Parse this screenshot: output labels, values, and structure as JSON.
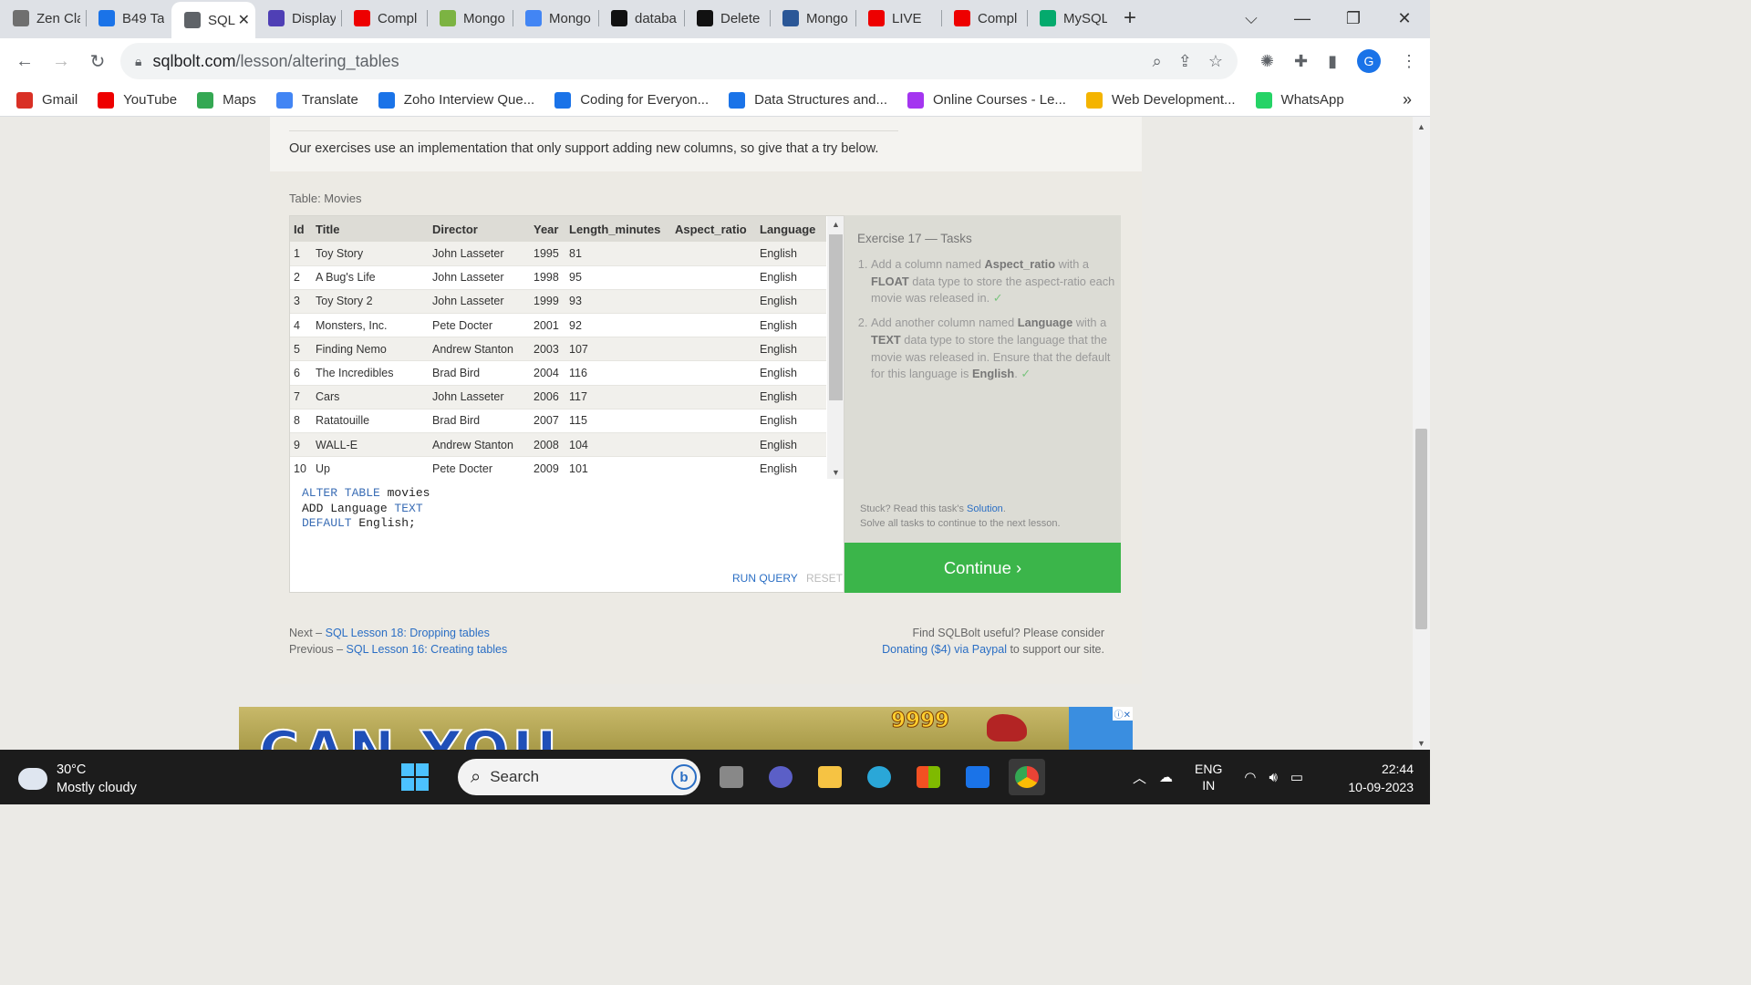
{
  "browser": {
    "tabs": [
      {
        "label": "Zen Cla",
        "icon": "classroom-icon",
        "color": "#6f6f6f"
      },
      {
        "label": "B49 Ta",
        "icon": "zoho-z-icon",
        "color": "#1a73e8"
      },
      {
        "label": "SQL",
        "icon": "database-icon",
        "color": "#5f6368",
        "active": true
      },
      {
        "label": "Display",
        "icon": "b-icon",
        "color": "#4f3fb5"
      },
      {
        "label": "Compl",
        "icon": "youtube-icon",
        "color": "#e00"
      },
      {
        "label": "Mongo",
        "icon": "leaf-icon",
        "color": "#7cb342"
      },
      {
        "label": "Mongo",
        "icon": "docs-icon",
        "color": "#4285f4"
      },
      {
        "label": "databa",
        "icon": "github-icon",
        "color": "#111"
      },
      {
        "label": "Delete",
        "icon": "mongodb-icon",
        "color": "#111"
      },
      {
        "label": "Mongo",
        "icon": "hash-icon",
        "color": "#2b5797"
      },
      {
        "label": "LIVE",
        "icon": "youtube-icon",
        "color": "#e00"
      },
      {
        "label": "Compl",
        "icon": "youtube-icon",
        "color": "#e00"
      },
      {
        "label": "MySQL",
        "icon": "w3-icon",
        "color": "#04aa6d"
      }
    ],
    "new_tab": "+",
    "url_host": "sqlbolt.com",
    "url_path": "/lesson/altering_tables",
    "profile_initial": "G",
    "bookmarks": [
      {
        "label": "Gmail",
        "icon": "gmail-icon",
        "color": "#d93025"
      },
      {
        "label": "YouTube",
        "icon": "youtube-icon",
        "color": "#e00"
      },
      {
        "label": "Maps",
        "icon": "maps-pin-icon",
        "color": "#34a853"
      },
      {
        "label": "Translate",
        "icon": "translate-icon",
        "color": "#4285f4"
      },
      {
        "label": "Zoho Interview Que...",
        "icon": "zoho-icon",
        "color": "#1a73e8"
      },
      {
        "label": "Coding for Everyon...",
        "icon": "c-icon",
        "color": "#1a73e8"
      },
      {
        "label": "Data Structures and...",
        "icon": "c-icon",
        "color": "#1a73e8"
      },
      {
        "label": "Online Courses - Le...",
        "icon": "udemy-icon",
        "color": "#a435f0"
      },
      {
        "label": "Web Development...",
        "icon": "bulb-icon",
        "color": "#f4b400"
      },
      {
        "label": "WhatsApp",
        "icon": "whatsapp-icon",
        "color": "#25d366"
      }
    ],
    "bookmarks_more": "»"
  },
  "lesson": {
    "intro": "Our exercises use an implementation that only support adding new columns, so give that a try below.",
    "table_caption": "Table: Movies",
    "columns": [
      "Id",
      "Title",
      "Director",
      "Year",
      "Length_minutes",
      "Aspect_ratio",
      "Language"
    ],
    "rows": [
      [
        "1",
        "Toy Story",
        "John Lasseter",
        "1995",
        "81",
        "",
        "English"
      ],
      [
        "2",
        "A Bug's Life",
        "John Lasseter",
        "1998",
        "95",
        "",
        "English"
      ],
      [
        "3",
        "Toy Story 2",
        "John Lasseter",
        "1999",
        "93",
        "",
        "English"
      ],
      [
        "4",
        "Monsters, Inc.",
        "Pete Docter",
        "2001",
        "92",
        "",
        "English"
      ],
      [
        "5",
        "Finding Nemo",
        "Andrew Stanton",
        "2003",
        "107",
        "",
        "English"
      ],
      [
        "6",
        "The Incredibles",
        "Brad Bird",
        "2004",
        "116",
        "",
        "English"
      ],
      [
        "7",
        "Cars",
        "John Lasseter",
        "2006",
        "117",
        "",
        "English"
      ],
      [
        "8",
        "Ratatouille",
        "Brad Bird",
        "2007",
        "115",
        "",
        "English"
      ],
      [
        "9",
        "WALL-E",
        "Andrew Stanton",
        "2008",
        "104",
        "",
        "English"
      ],
      [
        "10",
        "Up",
        "Pete Docter",
        "2009",
        "101",
        "",
        "English"
      ]
    ],
    "query": {
      "line1_kw": "ALTER TABLE",
      "line1_rest": " movies",
      "line2_a": "ADD Language ",
      "line2_kw": "TEXT",
      "line3_kw": "DEFAULT",
      "line3_rest": " English;"
    },
    "run_label": "RUN QUERY",
    "reset_label": "RESET",
    "exercise_title": "Exercise 17 — Tasks",
    "tasks": [
      {
        "t1": "Add a column named ",
        "b1": "Aspect_ratio",
        "t2": " with a ",
        "b2": "FLOAT",
        "t3": " data type to store the aspect-ratio each movie was released in.",
        "check": "✓"
      },
      {
        "t1": "Add another column named ",
        "b1": "Language",
        "t2": " with a ",
        "b2": "TEXT",
        "t3": " data type to store the language that the movie was released in. Ensure that the default for this language is ",
        "b3": "English",
        "t4": ".",
        "check": "✓"
      }
    ],
    "stuck_text": "Stuck? Read this task's ",
    "solution_link": "Solution",
    "stuck_tail": ".",
    "solve_all": "Solve all tasks to continue to the next lesson.",
    "continue_label": "Continue ›",
    "next_prefix": "Next – ",
    "next_link": "SQL Lesson 18: Dropping tables",
    "prev_prefix": "Previous – ",
    "prev_link": "SQL Lesson 16: Creating tables",
    "support_line": "Find SQLBolt useful? Please consider",
    "donate_link": "Donating ($4) via Paypal",
    "donate_tail": " to support our site.",
    "ad_text": "CAN YOU",
    "ad_score": "9999"
  },
  "taskbar": {
    "temperature": "30°C",
    "weather": "Mostly cloudy",
    "search_placeholder": "Search",
    "lang_top": "ENG",
    "lang_bottom": "IN",
    "time": "22:44",
    "date": "10-09-2023"
  }
}
